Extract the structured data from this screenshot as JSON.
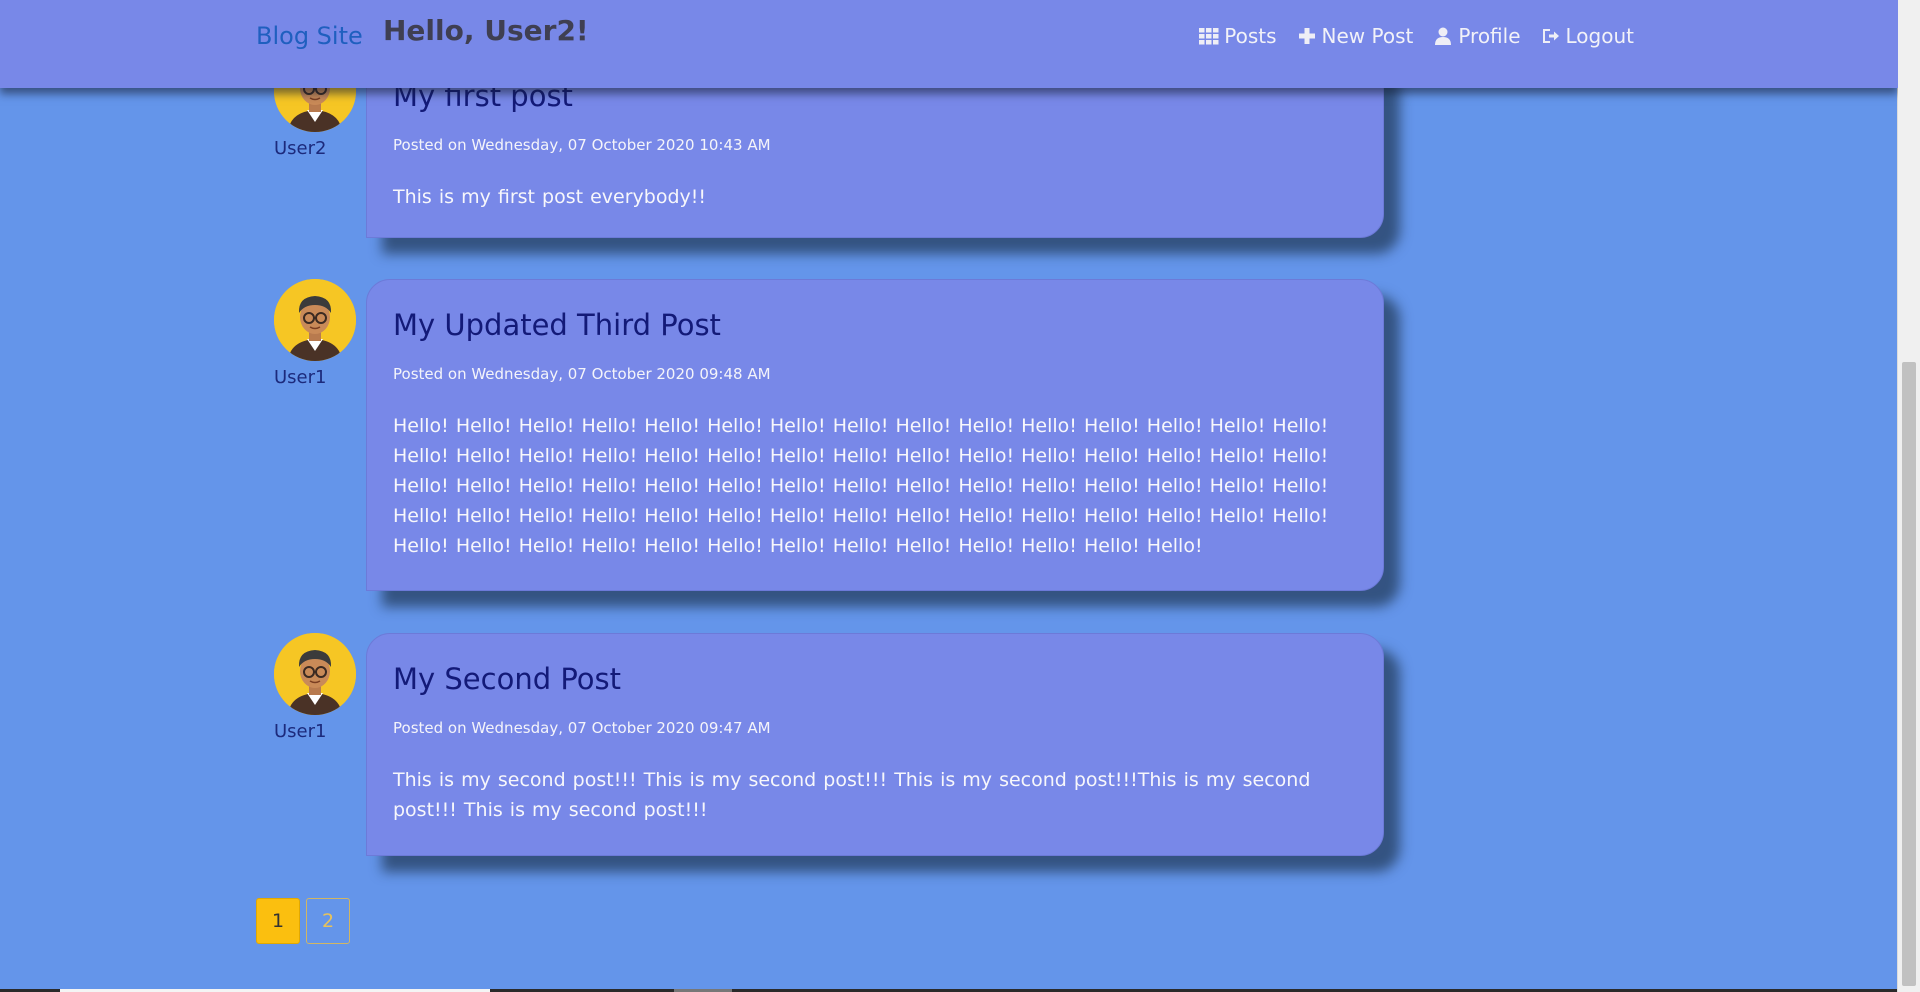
{
  "navbar": {
    "brand": "Blog Site",
    "greeting": "Hello, User2!",
    "links": [
      {
        "label": "Posts",
        "icon": "grid-icon"
      },
      {
        "label": "New Post",
        "icon": "plus-icon"
      },
      {
        "label": "Profile",
        "icon": "user-icon"
      },
      {
        "label": "Logout",
        "icon": "sign-out-icon"
      }
    ]
  },
  "posts": [
    {
      "title": "My first post",
      "author": "User2",
      "date": "Posted on Wednesday, 07 October 2020 10:43 AM",
      "body": "This is my first post everybody!!"
    },
    {
      "title": "My Updated Third Post",
      "author": "User1",
      "date": "Posted on Wednesday, 07 October 2020 09:48 AM",
      "body": "Hello! Hello! Hello! Hello! Hello! Hello! Hello! Hello! Hello! Hello! Hello! Hello! Hello! Hello! Hello! Hello! Hello! Hello! Hello! Hello! Hello! Hello! Hello! Hello! Hello! Hello! Hello! Hello! Hello! Hello! Hello! Hello! Hello! Hello! Hello! Hello! Hello! Hello! Hello! Hello! Hello! Hello! Hello! Hello! Hello! Hello! Hello! Hello! Hello! Hello! Hello! Hello! Hello! Hello! Hello! Hello! Hello! Hello! Hello! Hello! Hello! Hello! Hello! Hello! Hello! Hello! Hello! Hello! Hello! Hello! Hello! Hello! Hello!"
    },
    {
      "title": "My Second Post",
      "author": "User1",
      "date": "Posted on Wednesday, 07 October 2020 09:47 AM",
      "body": "This is my second post!!! This is my second post!!! This is my second post!!!This is my second post!!! This is my second post!!!"
    }
  ],
  "pagination": {
    "pages": [
      "1",
      "2"
    ],
    "current": "1"
  },
  "colors": {
    "page_background": "#6495ea",
    "card_background": "#7888e8",
    "title_color": "#131a78",
    "active_page": "#fbbf0f"
  }
}
